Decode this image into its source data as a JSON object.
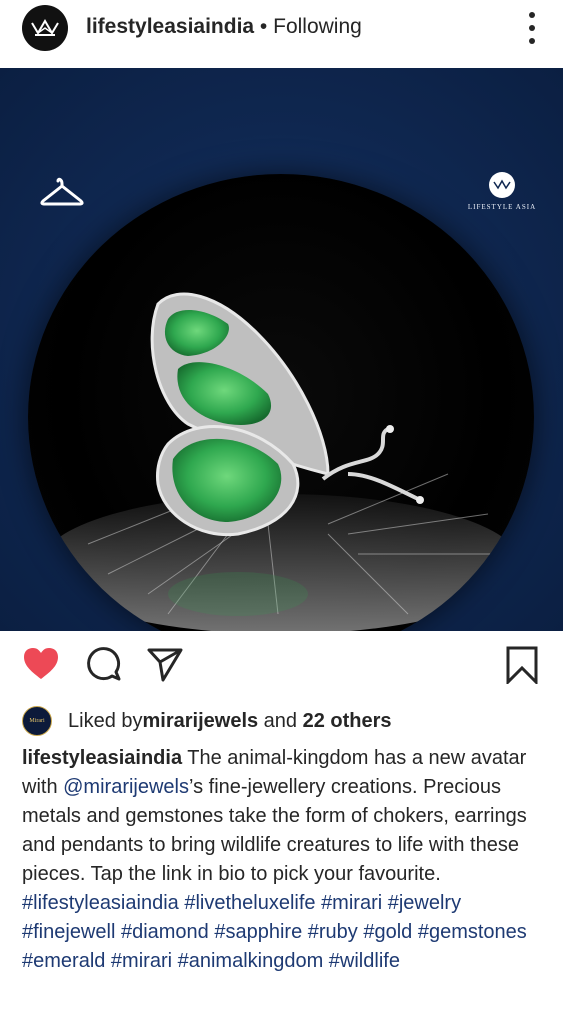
{
  "header": {
    "username": "lifestyleasiaindia",
    "separator": " • ",
    "follow_status": "Following"
  },
  "post": {
    "brand_label": "LIFESTYLE ASIA"
  },
  "likes": {
    "liked_by_prefix": "Liked by ",
    "liked_by_user": "mirarijewels",
    "and_text": " and ",
    "others": "22 others",
    "liker_avatar_text": "Mirari"
  },
  "caption": {
    "username": "lifestyleasiaindia",
    "text_1": " The animal-kingdom has a new avatar with ",
    "mention": "@mirarijewels",
    "text_2": "’s fine-jewellery creations. Precious metals and gemstones take the form of chokers, earrings and pendants to bring wildlife creatures to life with these pieces. Tap the link in bio to pick your favourite.",
    "hashtags": "#lifestyleasiaindia #livetheluxelife #mirari #jewelry #finejewell #diamond #sapphire #ruby #gold #gemstones #emerald #mirari #animalkingdom #wildlife"
  },
  "colors": {
    "like_red": "#ed4956",
    "link_blue": "#1e3a73",
    "photo_navy": "#0f2750",
    "emerald": "#2fa84f"
  }
}
